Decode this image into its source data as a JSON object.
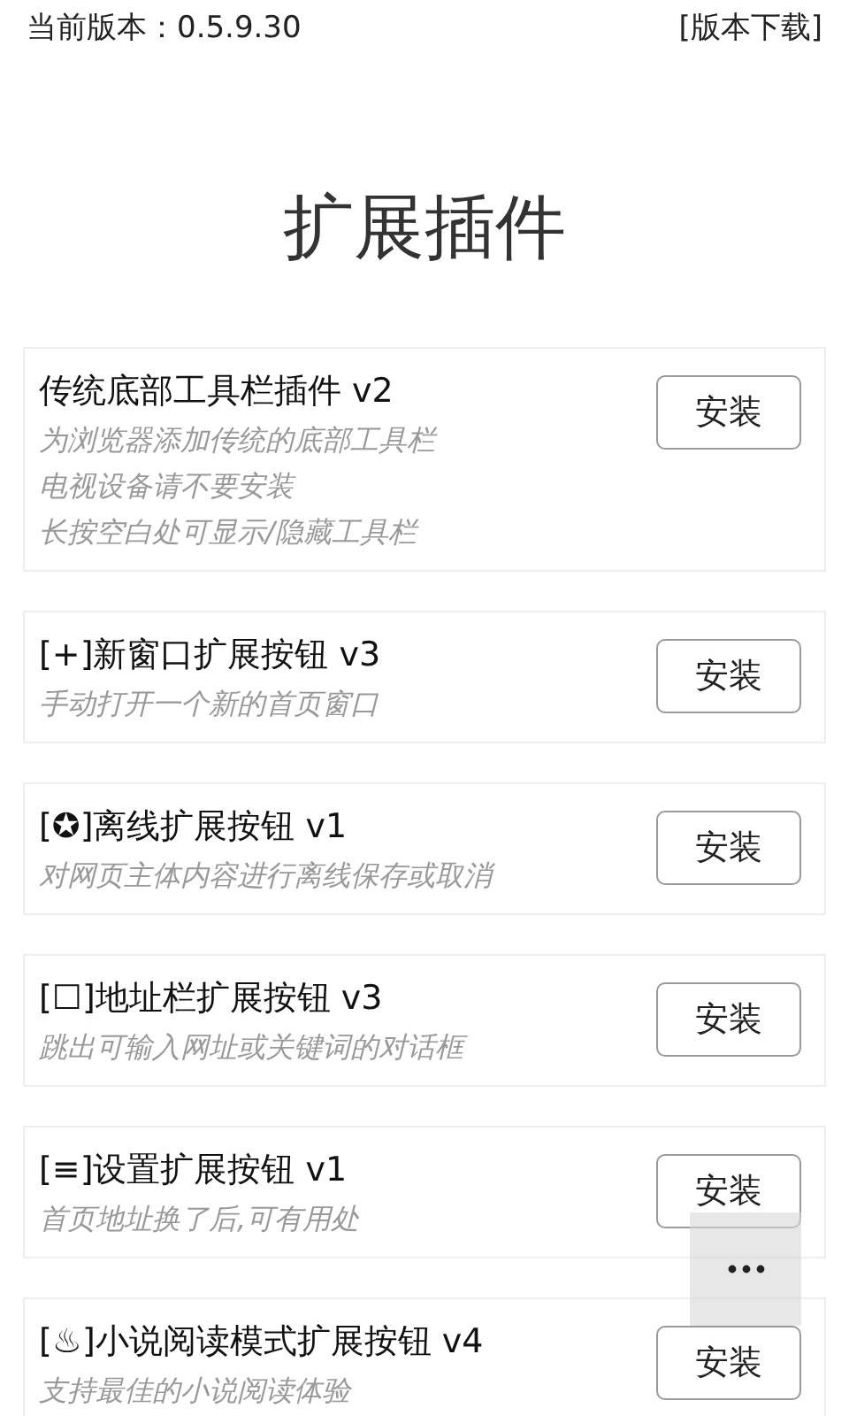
{
  "header": {
    "version": "当前版本：0.5.9.30",
    "download_link": "[版本下载]"
  },
  "title": "扩展插件",
  "plugins": [
    {
      "name": "传统底部工具栏插件 v2",
      "description": [
        "为浏览器添加传统的底部工具栏",
        "电视设备请不要安装",
        "长按空白处可显示/隐藏工具栏"
      ],
      "button": "安装"
    },
    {
      "name": "[+]新窗口扩展按钮 v3",
      "description": [
        "手动打开一个新的首页窗口"
      ],
      "button": "安装"
    },
    {
      "name": "[✪]离线扩展按钮 v1",
      "description": [
        "对网页主体内容进行离线保存或取消"
      ],
      "button": "安装"
    },
    {
      "name": "[☐]地址栏扩展按钮 v3",
      "description": [
        "跳出可输入网址或关键词的对话框"
      ],
      "button": "安装"
    },
    {
      "name": "[≡]设置扩展按钮 v1",
      "description": [
        "首页地址换了后,可有用处"
      ],
      "button": "安装"
    },
    {
      "name": "[♨]小说阅读模式扩展按钮 v4",
      "description": [
        "支持最佳的小说阅读体验"
      ],
      "button": "安装"
    }
  ],
  "floating_menu": {
    "kind": "more"
  }
}
